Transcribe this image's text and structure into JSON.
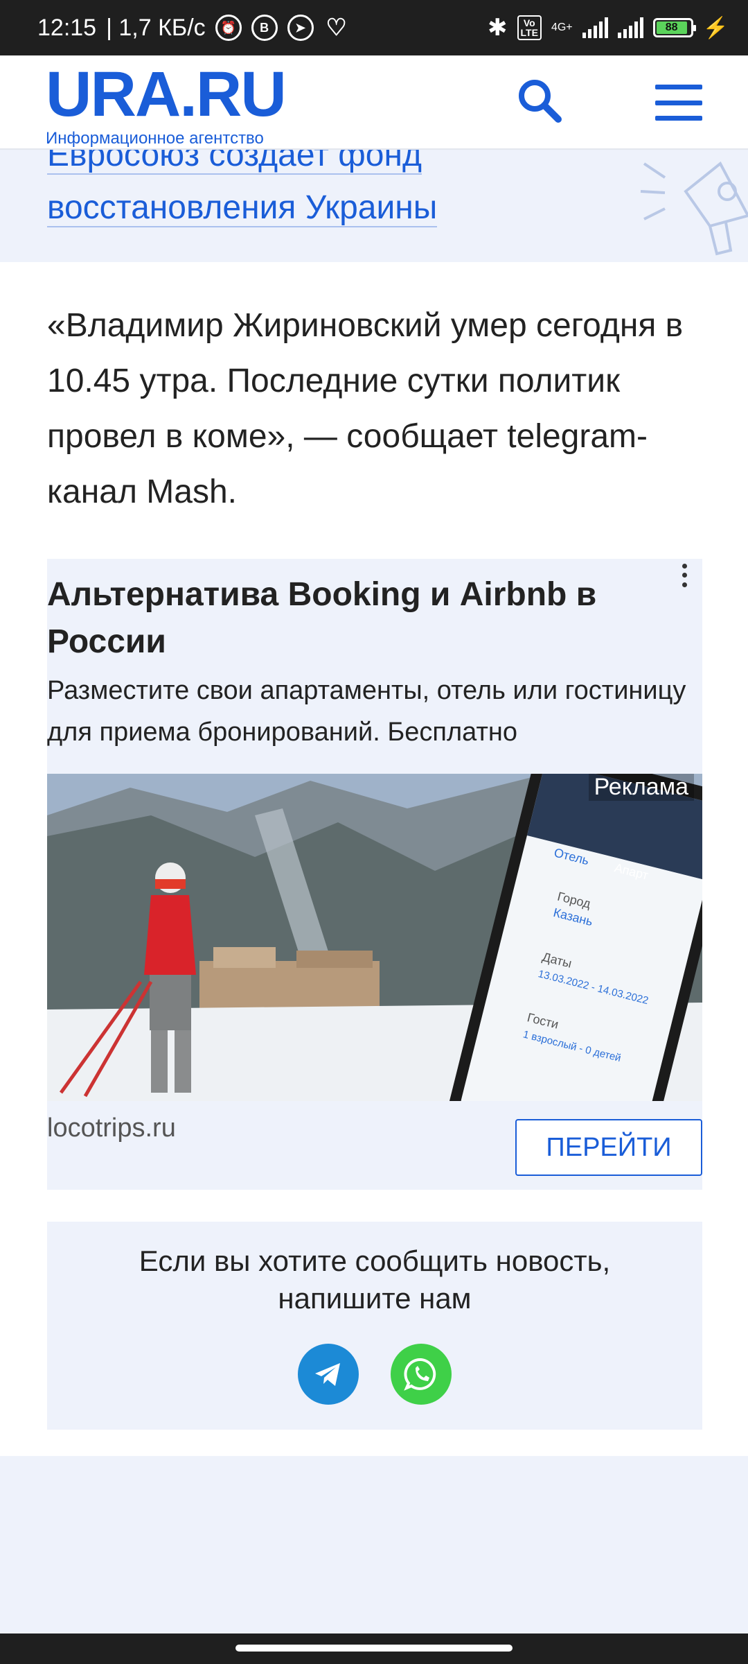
{
  "status_bar": {
    "time": "12:15",
    "net_speed": "| 1,7 КБ/с",
    "network": "4G+",
    "volte": "Vo\nLTE",
    "battery": "88"
  },
  "header": {
    "logo": "URA.RU",
    "logo_subtitle": "Информационное агентство"
  },
  "related": {
    "title_line1": "Евросоюз создает фонд",
    "title_line2": "восстановления Украины"
  },
  "article": {
    "lead": "«Владимир Жириновский умер сегодня в 10.45 утра. Последние сутки политик провел в коме», — сообщает telegram-канал Mash."
  },
  "ad": {
    "title": "Альтернатива Booking и Airbnb в России",
    "description": "Разместите свои апартаменты, отель или гостиницу для приема бронирований. Бесплатно",
    "label": "Реклама",
    "domain": "locotrips.ru",
    "cta": "ПЕРЕЙТИ",
    "phone": {
      "tab_hotel": "Отель",
      "tab_apart": "Апарт",
      "city_label": "Город",
      "city_value": "Казань",
      "dates_label": "Даты",
      "dates_value": "13.03.2022 - 14.03.2022",
      "guests_label": "Гости",
      "guests_value": "1 взрослый - 0 детей"
    }
  },
  "news_box": {
    "line1": "Если вы хотите сообщить новость,",
    "line2": "напишите нам"
  },
  "colors": {
    "brand": "#1a5dd8",
    "telegram": "#1c8ad6",
    "whatsapp": "#3fd048"
  }
}
